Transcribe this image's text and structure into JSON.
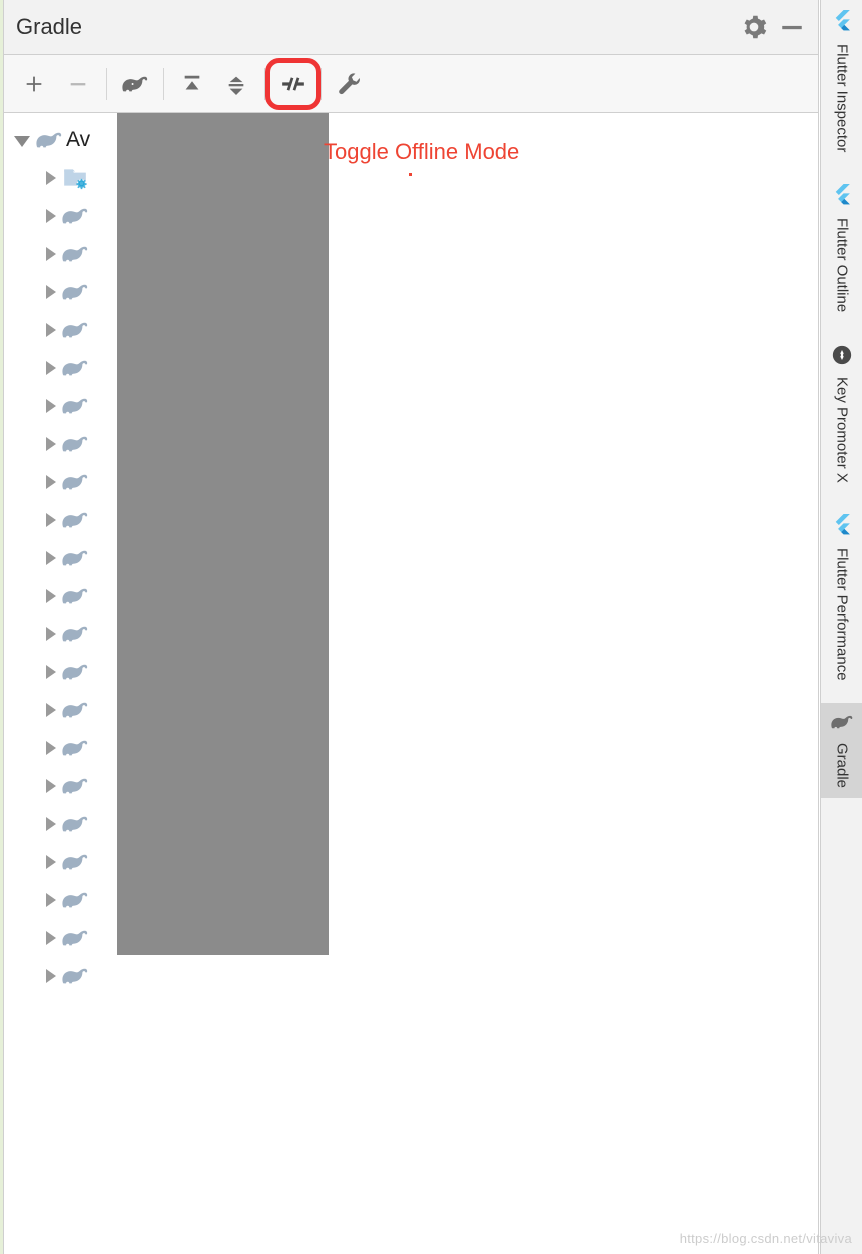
{
  "panel": {
    "title": "Gradle",
    "settings_tooltip": "Settings",
    "hide_tooltip": "Hide"
  },
  "toolbar": {
    "add": "Add",
    "remove": "Remove",
    "gradle": "Gradle",
    "expand_all": "Expand All",
    "collapse_all": "Collapse All",
    "toggle_offline": "Toggle Offline Mode",
    "build_settings": "Gradle Settings"
  },
  "tooltip": {
    "offline_label": "Toggle Offline Mode"
  },
  "tree": {
    "root_label": "Av",
    "child_count": 22
  },
  "right_tabs": [
    {
      "label": "Flutter Inspector",
      "icon": "flutter"
    },
    {
      "label": "Flutter Outline",
      "icon": "flutter"
    },
    {
      "label": "Key Promoter X",
      "icon": "keypromoter"
    },
    {
      "label": "Flutter Performance",
      "icon": "flutter"
    },
    {
      "label": "Gradle",
      "icon": "gradle",
      "active": true
    }
  ],
  "watermark": "https://blog.csdn.net/vitaviva"
}
